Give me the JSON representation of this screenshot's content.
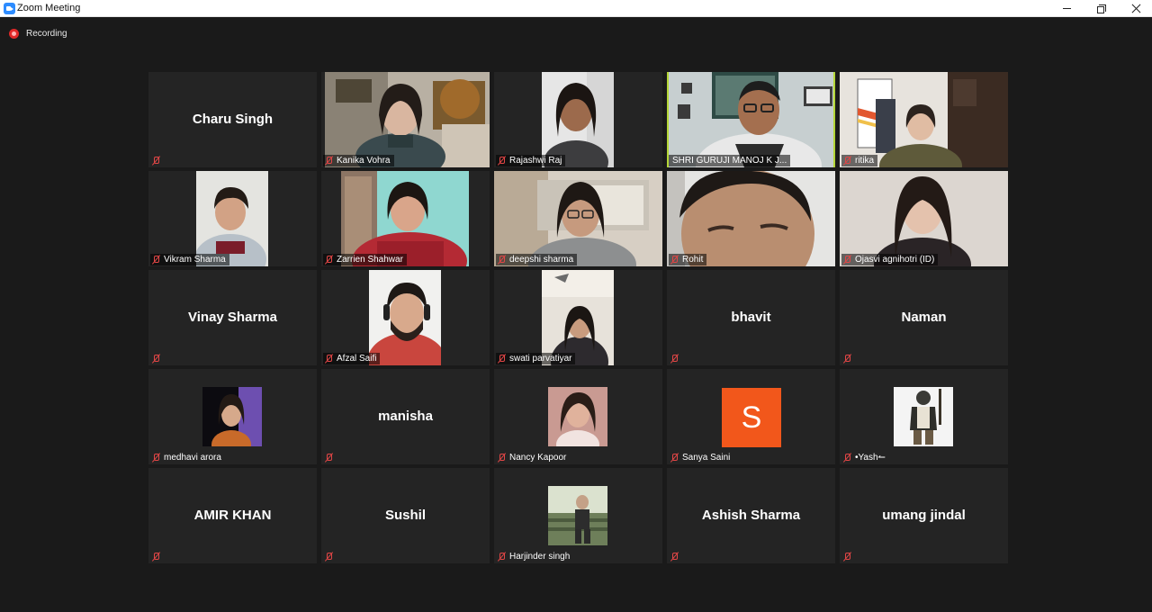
{
  "window": {
    "title": "Zoom Meeting"
  },
  "recording": {
    "label": "Recording"
  },
  "tiles": [
    {
      "name": "Charu Singh"
    },
    {
      "name": "Kanika Vohra"
    },
    {
      "name": "Rajashwi Raj"
    },
    {
      "name": "SHRI GURUJI MANOJ K J..."
    },
    {
      "name": "ritika"
    },
    {
      "name": "Vikram Sharma"
    },
    {
      "name": "Zarrien Shahwar"
    },
    {
      "name": "deepshi sharma"
    },
    {
      "name": "Rohit"
    },
    {
      "name": "Ojasvi agnihotri (ID)"
    },
    {
      "name": "Vinay Sharma"
    },
    {
      "name": "Afzal Saifi"
    },
    {
      "name": "swati parvatiyar"
    },
    {
      "name": "bhavit"
    },
    {
      "name": "Naman"
    },
    {
      "name": "medhavi arora"
    },
    {
      "name": "manisha"
    },
    {
      "name": "Nancy Kapoor"
    },
    {
      "name": "Sanya Saini",
      "initial": "S"
    },
    {
      "name": "•Yash↼"
    },
    {
      "name": "AMIR KHAN"
    },
    {
      "name": "Sushil"
    },
    {
      "name": "Harjinder singh"
    },
    {
      "name": "Ashish Sharma"
    },
    {
      "name": "umang jindal"
    }
  ],
  "colors": {
    "active_speaker": "#b4d637",
    "muted": "#e24646",
    "sanya_avatar": "#f2571b"
  }
}
